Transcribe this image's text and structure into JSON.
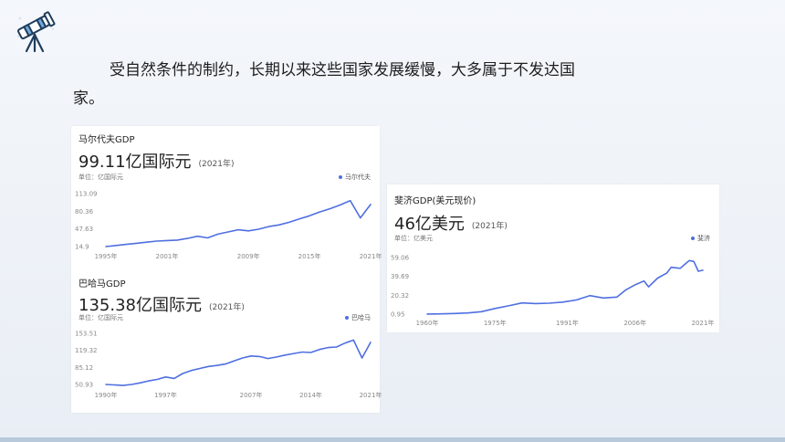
{
  "text": {
    "line1": "受自然条件的制约，长期以来这些国家发展缓慢，大多属于不发达国",
    "line2": "家。"
  },
  "charts": [
    {
      "title": "马尔代夫GDP",
      "value": "99.11亿国际元",
      "year_tag": "(2021年)",
      "unit": "单位：亿国际元",
      "legend": "马尔代夫"
    },
    {
      "title": "巴哈马GDP",
      "value": "135.38亿国际元",
      "year_tag": "(2021年)",
      "unit": "单位：亿国际元",
      "legend": "巴哈马"
    },
    {
      "title": "斐济GDP(美元现价)",
      "value": "46亿美元",
      "year_tag": "(2021年)",
      "unit": "单位：亿美元",
      "legend": "斐济"
    }
  ],
  "chart_data": [
    {
      "type": "line",
      "title": "马尔代夫GDP",
      "ylabel": "单位：亿国际元",
      "x_ticks": [
        "1995年",
        "2001年",
        "2009年",
        "2015年",
        "2021年"
      ],
      "y_ticks": [
        "113.09",
        "80.36",
        "47.63",
        "14.9"
      ],
      "ylim": [
        14.9,
        113.09
      ],
      "xlim": [
        1995,
        2021
      ],
      "grid": false,
      "legend_position": "top-right",
      "color": "#4f6fe0",
      "series": [
        {
          "name": "马尔代夫",
          "x": [
            1995,
            1996,
            1997,
            1998,
            1999,
            2000,
            2001,
            2002,
            2003,
            2004,
            2005,
            2006,
            2007,
            2008,
            2009,
            2010,
            2011,
            2012,
            2013,
            2014,
            2015,
            2016,
            2017,
            2018,
            2019,
            2020,
            2021
          ],
          "y": [
            14.9,
            17,
            19,
            21,
            23,
            25,
            26,
            27,
            30,
            34,
            31,
            38,
            42,
            46,
            44,
            47,
            52,
            55,
            60,
            66,
            72,
            79,
            85,
            92,
            100,
            68,
            93
          ]
        }
      ]
    },
    {
      "type": "line",
      "title": "巴哈马GDP",
      "ylabel": "单位：亿国际元",
      "x_ticks": [
        "1990年",
        "1997年",
        "2007年",
        "2014年",
        "2021年"
      ],
      "y_ticks": [
        "153.51",
        "119.32",
        "85.12",
        "50.93"
      ],
      "ylim": [
        50.93,
        153.51
      ],
      "xlim": [
        1990,
        2021
      ],
      "grid": false,
      "legend_position": "top-right",
      "color": "#4f6fe0",
      "series": [
        {
          "name": "巴哈马",
          "x": [
            1990,
            1991,
            1992,
            1993,
            1994,
            1995,
            1996,
            1997,
            1998,
            1999,
            2000,
            2001,
            2002,
            2003,
            2004,
            2005,
            2006,
            2007,
            2008,
            2009,
            2010,
            2011,
            2012,
            2013,
            2014,
            2015,
            2016,
            2017,
            2018,
            2019,
            2020,
            2021
          ],
          "y": [
            50.9,
            50,
            49,
            51,
            54,
            58,
            61,
            66,
            63,
            73,
            79,
            83,
            87,
            89,
            92,
            98,
            104,
            108,
            107,
            103,
            106,
            110,
            113,
            116,
            115,
            121,
            125,
            126,
            134,
            140,
            104,
            135.38
          ]
        }
      ]
    },
    {
      "type": "line",
      "title": "斐济GDP(美元现价)",
      "ylabel": "单位：亿美元",
      "x_ticks": [
        "1960年",
        "1975年",
        "1991年",
        "2006年",
        "2021年"
      ],
      "y_ticks": [
        "59.06",
        "39.69",
        "20.32",
        "0.95"
      ],
      "ylim": [
        0.95,
        59.06
      ],
      "xlim": [
        1960,
        2021
      ],
      "grid": false,
      "legend_position": "top-right",
      "color": "#4f6fe0",
      "series": [
        {
          "name": "斐济",
          "x": [
            1960,
            1963,
            1966,
            1969,
            1972,
            1975,
            1978,
            1981,
            1984,
            1987,
            1990,
            1993,
            1996,
            1999,
            2002,
            2004,
            2006,
            2008,
            2009,
            2011,
            2013,
            2014,
            2016,
            2017,
            2018,
            2019,
            2020,
            2021
          ],
          "y": [
            1,
            1.2,
            1.6,
            2.2,
            3.5,
            6.8,
            9.5,
            12.5,
            11.8,
            12.2,
            13.3,
            15.5,
            20,
            17.5,
            18.5,
            26,
            31,
            35,
            29,
            38,
            43,
            49,
            48,
            52,
            56,
            55,
            45,
            46
          ]
        }
      ]
    }
  ]
}
